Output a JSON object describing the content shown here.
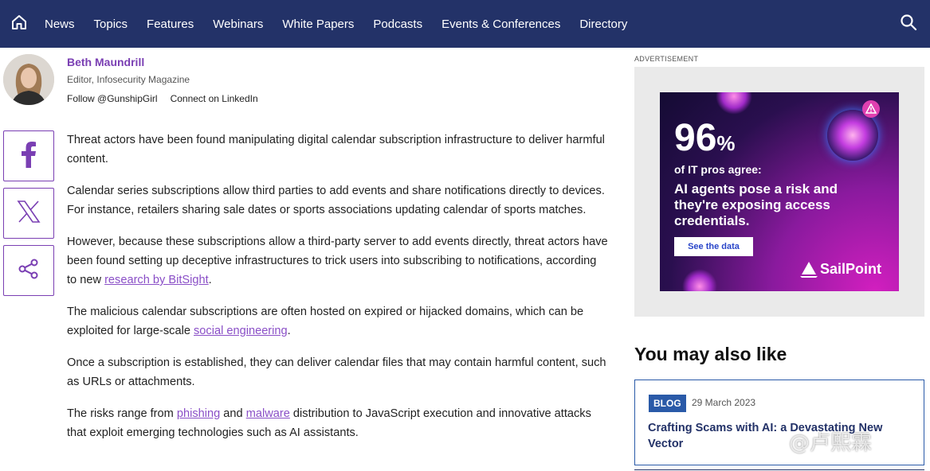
{
  "nav": {
    "home_icon": "home-icon",
    "links": [
      "News",
      "Topics",
      "Features",
      "Webinars",
      "White Papers",
      "Podcasts",
      "Events & Conferences",
      "Directory"
    ],
    "search_icon": "search-icon",
    "background": "#233268"
  },
  "author": {
    "name": "Beth Maundrill",
    "role": "Editor, Infosecurity Magazine",
    "follow": "Follow @GunshipGirl",
    "linkedin": "Connect on LinkedIn"
  },
  "share": {
    "facebook_icon": "facebook-icon",
    "x_icon": "x-icon",
    "share_icon": "share-icon"
  },
  "article": {
    "p1": "Threat actors have been found manipulating digital calendar subscription infrastructure to deliver harmful content.",
    "p2": "Calendar series subscriptions allow third parties to add events and share notifications directly to devices. For instance, retailers sharing sale dates or sports associations updating calendar of sports matches.",
    "p3_before": "However, because these subscriptions allow a third-party server to add events directly, threat actors have been found setting up deceptive infrastructures to trick users into subscribing to notifications, according to new ",
    "p3_link": "research by BitSight",
    "p3_after": ".",
    "p4_before": "The malicious calendar subscriptions are often hosted on expired or hijacked domains, which can be exploited for large-scale ",
    "p4_link": "social engineering",
    "p4_after": ".",
    "p5": "Once a subscription is established, they can deliver calendar files that may contain harmful content, such as URLs or attachments.",
    "p6_before": "The risks range from ",
    "p6_link1": "phishing",
    "p6_mid": " and ",
    "p6_link2": "malware",
    "p6_after": " distribution to JavaScript execution and innovative attacks that exploit emerging technologies such as AI assistants.",
    "link_color": "#8a4fc7"
  },
  "ad": {
    "label": "ADVERTISEMENT",
    "stat": "96",
    "stat_unit": "%",
    "subhead": "of IT pros agree:",
    "message": "AI agents pose a risk and they're exposing access credentials.",
    "cta": "See the data",
    "brand": "SailPoint"
  },
  "related": {
    "title": "You may also like",
    "card": {
      "badge": "BLOG",
      "date": "29 March 2023",
      "title": "Crafting Scams with AI: a Devastating New Vector"
    }
  },
  "watermark": "@卢熙霖"
}
